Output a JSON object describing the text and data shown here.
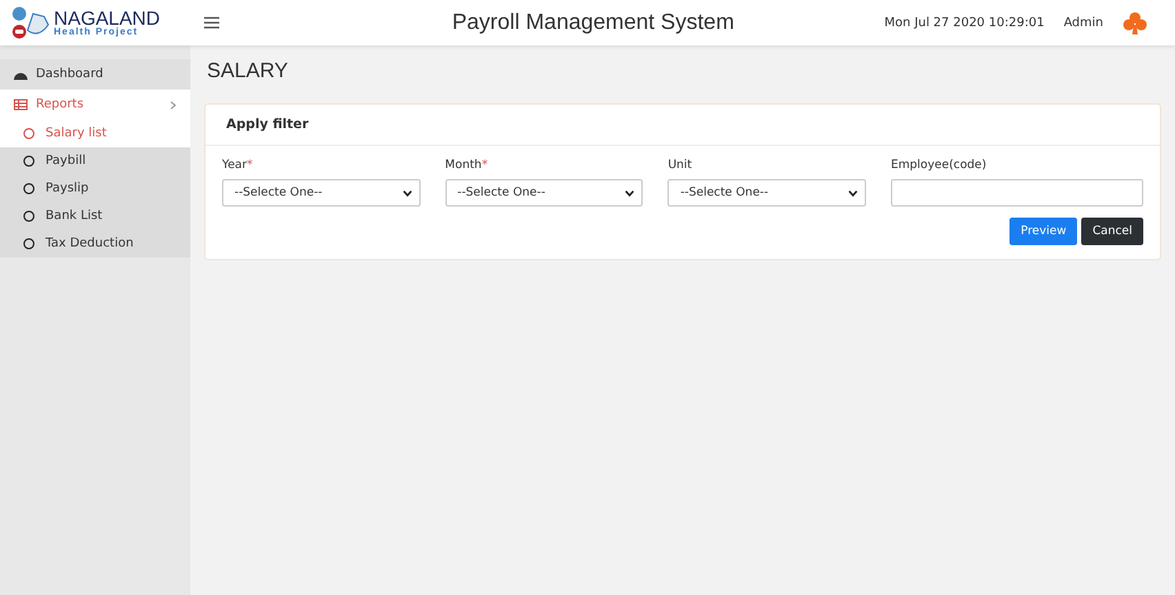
{
  "logo": {
    "title": "NAGALAND",
    "subtitle": "Health Project"
  },
  "header": {
    "title": "Payroll Management System",
    "datetime": "Mon Jul 27 2020 10:29:01",
    "user": "Admin"
  },
  "sidebar": {
    "items": [
      {
        "label": "Dashboard",
        "kind": "link",
        "selected": false
      },
      {
        "label": "Reports",
        "kind": "group",
        "expanded": true,
        "selected": true,
        "children": [
          {
            "label": "Salary list",
            "selected": true
          },
          {
            "label": "Paybill",
            "selected": false
          },
          {
            "label": "Payslip",
            "selected": false
          },
          {
            "label": "Bank List",
            "selected": false
          },
          {
            "label": "Tax Deduction",
            "selected": false
          }
        ]
      }
    ]
  },
  "page": {
    "title": "SALARY"
  },
  "filter": {
    "title": "Apply filter",
    "fields": [
      {
        "label": "Year",
        "required_mark": "*",
        "kind": "select",
        "value": "--Selecte One--"
      },
      {
        "label": "Month",
        "required_mark": "*",
        "kind": "select",
        "value": "--Selecte One--"
      },
      {
        "label": "Unit",
        "kind": "select",
        "value": "--Selecte One--"
      },
      {
        "label": "Employee(code)",
        "kind": "input"
      }
    ],
    "buttons": [
      {
        "label": "Preview",
        "kind": "primary"
      },
      {
        "label": "Cancel",
        "kind": "dark"
      }
    ]
  }
}
